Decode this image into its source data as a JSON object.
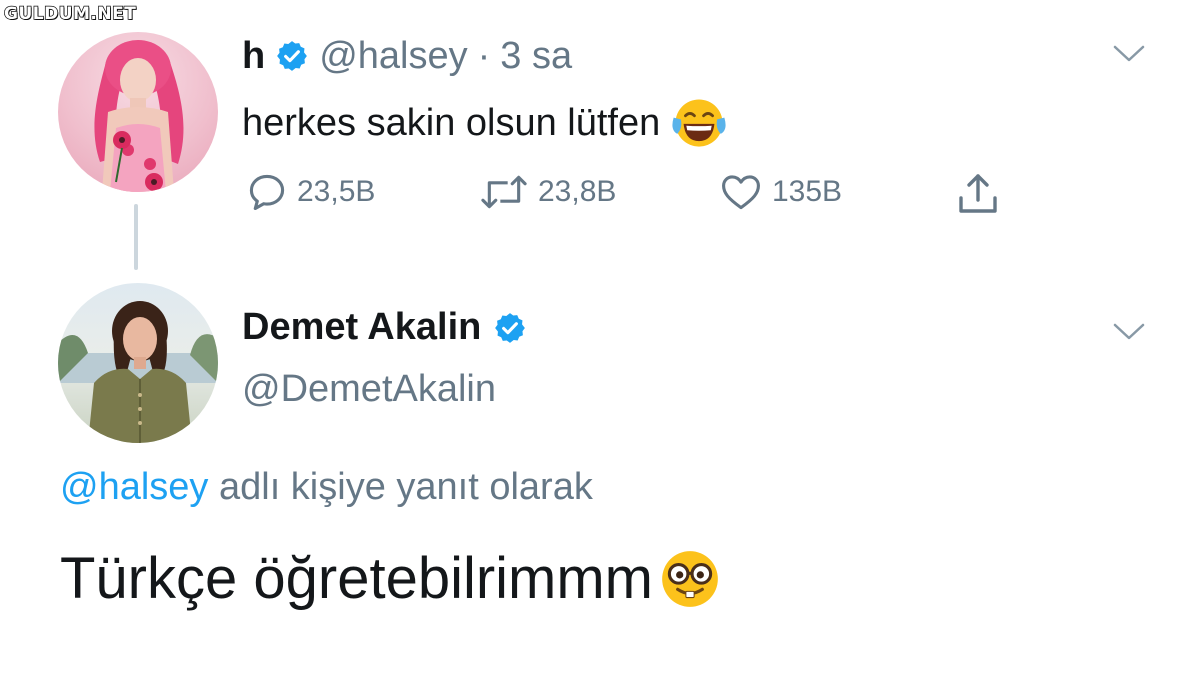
{
  "watermark": "GULDUM.NET",
  "colors": {
    "link": "#1da1f2",
    "muted": "#657786",
    "text": "#14171a",
    "verified": "#1da1f2"
  },
  "original_tweet": {
    "display_name": "h",
    "handle": "@halsey",
    "separator": "·",
    "time": "3 sa",
    "text": "herkes sakin olsun lütfen",
    "emoji": "face-with-tears-of-joy",
    "reply_count": "23,5B",
    "retweet_count": "23,8B",
    "like_count": "135B",
    "icons": [
      "reply-icon",
      "retweet-icon",
      "like-icon",
      "share-icon",
      "chevron-down-icon",
      "verified-badge-icon"
    ]
  },
  "reply_tweet": {
    "display_name": "Demet Akalin",
    "handle": "@DemetAkalin",
    "reply_mention": "@halsey",
    "reply_suffix": "adlı kişiye yanıt olarak",
    "text": "Türkçe öğretebilrimmm",
    "emoji": "nerd-face",
    "icons": [
      "verified-badge-icon",
      "chevron-down-icon"
    ]
  }
}
